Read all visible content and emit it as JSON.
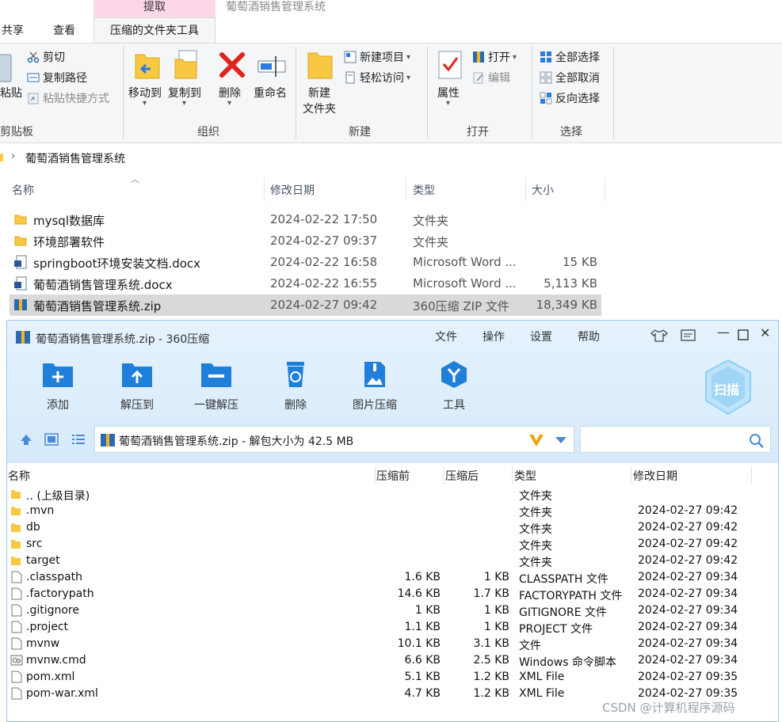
{
  "explorer": {
    "window_title": "葡萄酒销售管理系统",
    "context_tab": "提取",
    "tabs": [
      "共享",
      "查看"
    ],
    "active_tab": "压缩的文件夹工具",
    "clipboard": {
      "paste_label": "粘贴",
      "cut": "剪切",
      "copy_path": "复制路径",
      "paste_shortcut": "粘贴快捷方式",
      "group": "剪贴板"
    },
    "organize": {
      "move_to": "移动到",
      "copy_to": "复制到",
      "delete": "删除",
      "rename": "重命名",
      "group": "组织"
    },
    "new": {
      "new_folder_line1": "新建",
      "new_folder_line2": "文件夹",
      "new_item": "新建项目",
      "easy_access": "轻松访问",
      "group": "新建"
    },
    "open": {
      "properties": "属性",
      "open": "打开",
      "edit": "编辑",
      "group": "打开"
    },
    "select": {
      "select_all": "全部选择",
      "select_none": "全部取消",
      "invert": "反向选择",
      "group": "选择"
    },
    "address": "葡萄酒销售管理系统",
    "columns": {
      "name": "名称",
      "date": "修改日期",
      "type": "类型",
      "size": "大小"
    },
    "files": [
      {
        "name": "mysql数据库",
        "date": "2024-02-22 17:50",
        "type": "文件夹",
        "size": "",
        "icon": "folder-icon"
      },
      {
        "name": "环境部署软件",
        "date": "2024-02-27 09:37",
        "type": "文件夹",
        "size": "",
        "icon": "folder-icon"
      },
      {
        "name": "springboot环境安装文档.docx",
        "date": "2024-02-22 16:58",
        "type": "Microsoft Word ...",
        "size": "15 KB",
        "icon": "word-doc-icon"
      },
      {
        "name": "葡萄酒销售管理系统.docx",
        "date": "2024-02-22 16:55",
        "type": "Microsoft Word ...",
        "size": "5,113 KB",
        "icon": "word-doc-icon"
      },
      {
        "name": "葡萄酒销售管理系统.zip",
        "date": "2024-02-27 09:42",
        "type": "360压缩 ZIP 文件",
        "size": "18,349 KB",
        "icon": "zip-archive-icon"
      }
    ]
  },
  "zip": {
    "title": "葡萄酒销售管理系统.zip - 360压缩",
    "menu": [
      "文件",
      "操作",
      "设置",
      "帮助"
    ],
    "tools": [
      "添加",
      "解压到",
      "一键解压",
      "删除",
      "图片压缩",
      "工具"
    ],
    "scan_label": "扫描",
    "path": "葡萄酒销售管理系统.zip - 解包大小为 42.5 MB",
    "columns": {
      "name": "名称",
      "before": "压缩前",
      "after": "压缩后",
      "type": "类型",
      "date": "修改日期"
    },
    "rows": [
      {
        "name": ".. (上级目录)",
        "before": "",
        "after": "",
        "type": "文件夹",
        "date": "",
        "icon": "folder-icon"
      },
      {
        "name": ".mvn",
        "before": "",
        "after": "",
        "type": "文件夹",
        "date": "2024-02-27 09:42",
        "icon": "folder-icon"
      },
      {
        "name": "db",
        "before": "",
        "after": "",
        "type": "文件夹",
        "date": "2024-02-27 09:42",
        "icon": "folder-icon"
      },
      {
        "name": "src",
        "before": "",
        "after": "",
        "type": "文件夹",
        "date": "2024-02-27 09:42",
        "icon": "folder-icon"
      },
      {
        "name": "target",
        "before": "",
        "after": "",
        "type": "文件夹",
        "date": "2024-02-27 09:42",
        "icon": "folder-icon"
      },
      {
        "name": ".classpath",
        "before": "1.6 KB",
        "after": "1 KB",
        "type": "CLASSPATH 文件",
        "date": "2024-02-27 09:34",
        "icon": "file-icon"
      },
      {
        "name": ".factorypath",
        "before": "14.6 KB",
        "after": "1.7 KB",
        "type": "FACTORYPATH 文件",
        "date": "2024-02-27 09:34",
        "icon": "file-icon"
      },
      {
        "name": ".gitignore",
        "before": "1 KB",
        "after": "1 KB",
        "type": "GITIGNORE 文件",
        "date": "2024-02-27 09:34",
        "icon": "file-icon"
      },
      {
        "name": ".project",
        "before": "1.1 KB",
        "after": "1 KB",
        "type": "PROJECT 文件",
        "date": "2024-02-27 09:34",
        "icon": "file-icon"
      },
      {
        "name": "mvnw",
        "before": "10.1 KB",
        "after": "3.1 KB",
        "type": "文件",
        "date": "2024-02-27 09:34",
        "icon": "file-icon"
      },
      {
        "name": "mvnw.cmd",
        "before": "6.6 KB",
        "after": "2.5 KB",
        "type": "Windows 命令脚本",
        "date": "2024-02-27 09:34",
        "icon": "cmd-script-icon"
      },
      {
        "name": "pom.xml",
        "before": "5.1 KB",
        "after": "1.2 KB",
        "type": "XML File",
        "date": "2024-02-27 09:35",
        "icon": "file-icon"
      },
      {
        "name": "pom-war.xml",
        "before": "4.7 KB",
        "after": "1.2 KB",
        "type": "XML File",
        "date": "2024-02-27 09:35",
        "icon": "file-icon"
      }
    ]
  },
  "watermark": "CSDN @计算机程序源码"
}
